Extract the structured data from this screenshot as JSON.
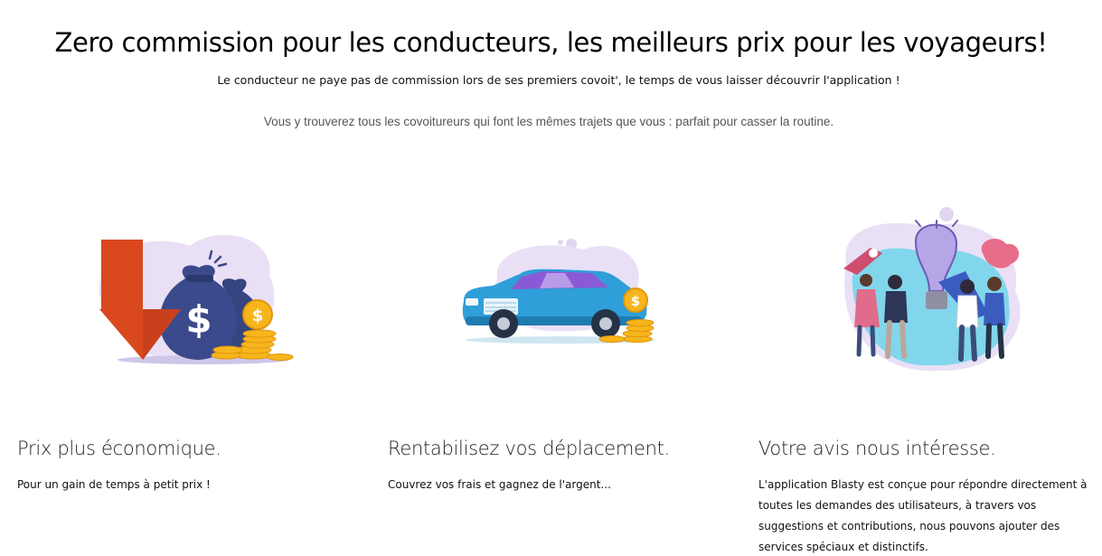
{
  "hero": {
    "title": "Zero commission pour les conducteurs, les meilleurs prix pour les voyageurs!",
    "subtitle": "Le conducteur ne paye pas de commission lors de ses premiers covoit', le temps de vous laisser découvrir l'application !",
    "subtitle2": "Vous y trouverez tous les covoitureurs qui font les mêmes trajets que vous : parfait pour casser la routine."
  },
  "features": [
    {
      "illustration": "money-bags-down-arrow-illustration",
      "title": "Prix plus économique.",
      "text": "Pour un gain de temps à petit prix !"
    },
    {
      "illustration": "blue-car-coins-illustration",
      "title": "Rentabilisez vos déplacement.",
      "text": "Couvrez vos frais et gagnez de l'argent..."
    },
    {
      "illustration": "people-lightbulb-ideas-illustration",
      "title": "Votre avis nous intéresse.",
      "text": "L'application Blasty est conçue pour répondre directement à toutes les demandes des utilisateurs, à travers vos suggestions et contributions, nous pouvons ajouter des services spéciaux et distinctifs."
    }
  ],
  "colors": {
    "blob": "#e6dcf5",
    "arrow": "#d9481f",
    "bag": "#3b4a8c",
    "coin": "#f7b51c",
    "car": "#2e9fd8",
    "teal_blob": "#6fd3ea"
  }
}
